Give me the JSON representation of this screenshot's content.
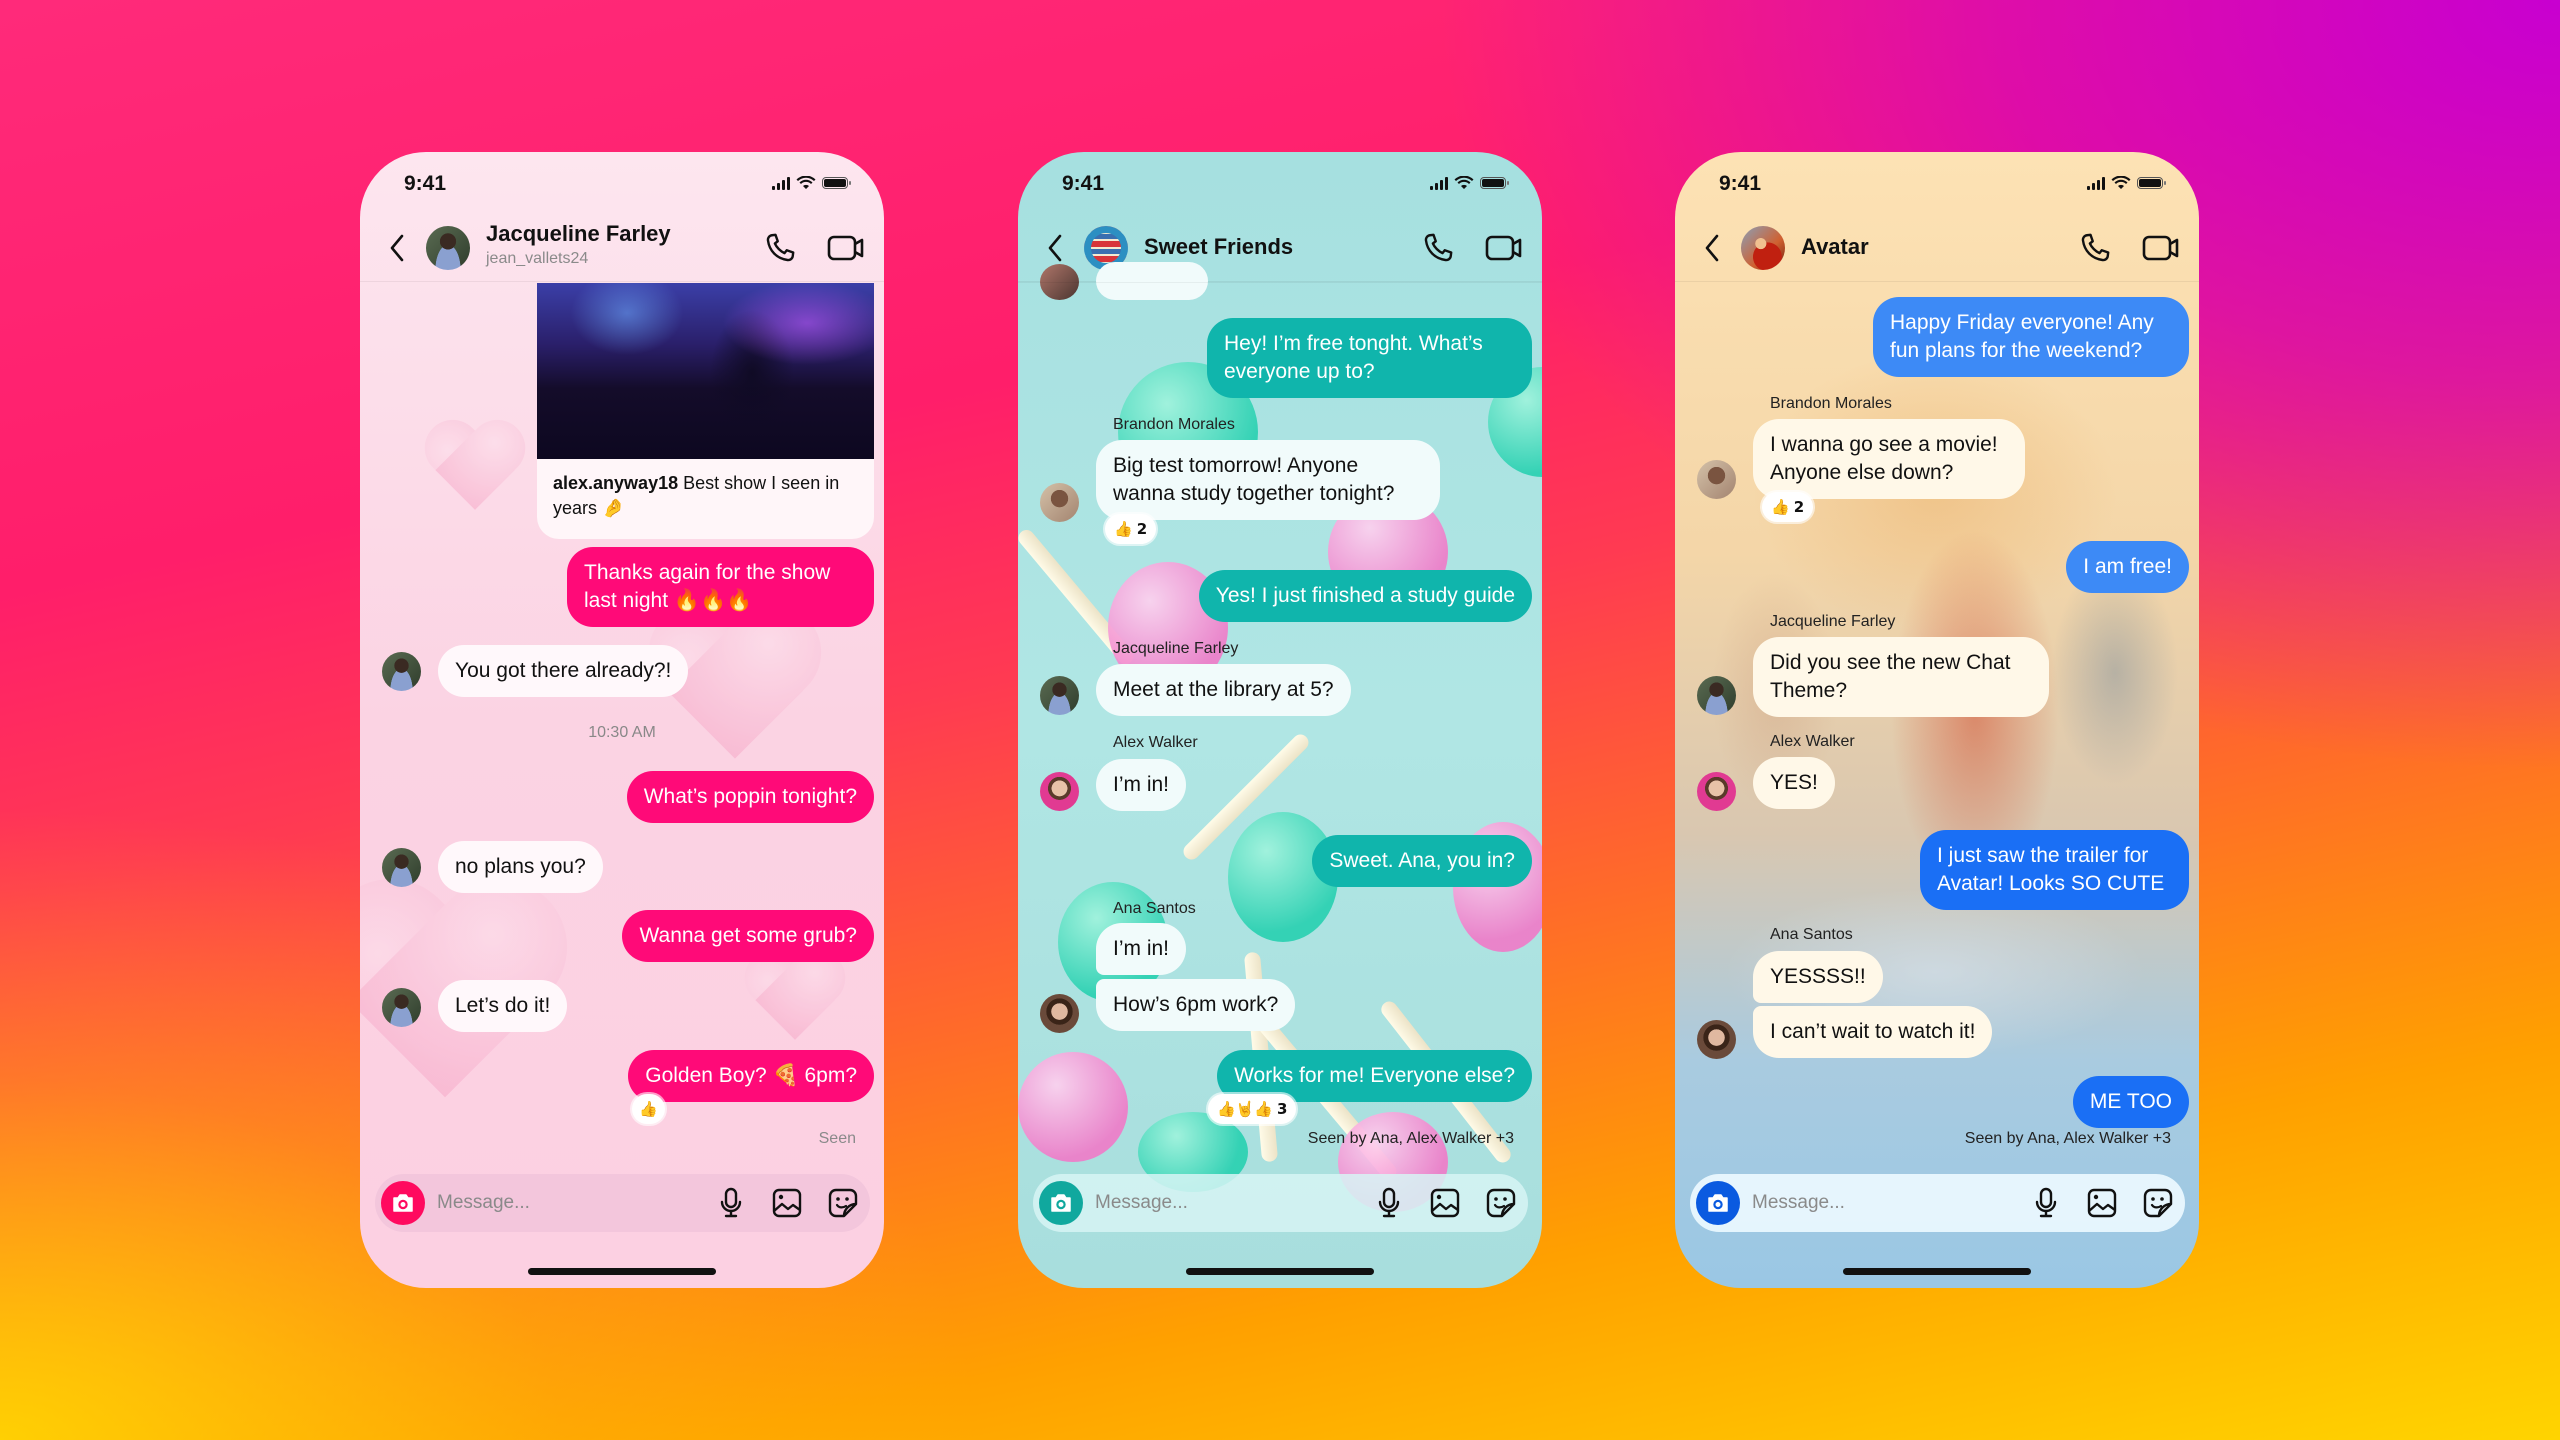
{
  "colors": {
    "pink_outgoing": "#ff0a78",
    "teal_outgoing": "#10b5ac",
    "blue_outgoing": "#1a6ff5"
  },
  "phones": [
    {
      "theme": "hearts",
      "status": {
        "time": "9:41"
      },
      "header": {
        "title": "Jacqueline Farley",
        "subtitle": "jean_vallets24",
        "avatar": "person-avatar"
      },
      "shared_post": {
        "username": "alex.anyway18",
        "caption": "Best show I seen in years 🤌",
        "image": "concert-crowd-photo"
      },
      "messages": [
        {
          "type": "outgoing",
          "text": "Thanks again for the show\nlast night 🔥🔥🔥"
        },
        {
          "type": "incoming",
          "text": "You got there already?!"
        },
        {
          "type": "timestamp",
          "text": "10:30 AM"
        },
        {
          "type": "outgoing",
          "text": "What’s poppin tonight?"
        },
        {
          "type": "incoming",
          "text": "no plans you?"
        },
        {
          "type": "outgoing",
          "text": "Wanna get some grub?"
        },
        {
          "type": "incoming",
          "text": "Let’s do it!"
        },
        {
          "type": "outgoing",
          "text": "Golden Boy? 🍕 6pm?",
          "reaction": "👍"
        }
      ],
      "seen": "Seen",
      "composer": {
        "placeholder": "Message..."
      }
    },
    {
      "theme": "lollipops",
      "status": {
        "time": "9:41"
      },
      "header": {
        "title": "Sweet Friends",
        "avatar": "books-group-avatar"
      },
      "messages": [
        {
          "type": "outgoing",
          "text": "Hey! I’m free tonght. What’s\neveryone up to?"
        },
        {
          "type": "incoming",
          "sender": "Brandon Morales",
          "text": "Big test tomorrow! Anyone\nwanna study together tonight?",
          "reaction": "👍",
          "reaction_count": "2"
        },
        {
          "type": "outgoing",
          "text": "Yes! I just finished a study guide"
        },
        {
          "type": "incoming",
          "sender": "Jacqueline Farley",
          "text": "Meet at the library at 5?"
        },
        {
          "type": "incoming",
          "sender": "Alex Walker",
          "text": "I’m in!"
        },
        {
          "type": "outgoing",
          "text": "Sweet. Ana, you in?"
        },
        {
          "type": "incoming",
          "sender": "Ana Santos",
          "text": "I’m in!"
        },
        {
          "type": "incoming",
          "text": "How’s 6pm work?"
        },
        {
          "type": "outgoing",
          "text": "Works for me! Everyone else?",
          "reaction": "👍🤘👍",
          "reaction_count": "3"
        }
      ],
      "seen": "Seen by Ana, Alex Walker +3",
      "composer": {
        "placeholder": "Message..."
      }
    },
    {
      "theme": "avatar-poster",
      "status": {
        "time": "9:41"
      },
      "header": {
        "title": "Avatar",
        "avatar": "avatar-show-avatar"
      },
      "messages": [
        {
          "type": "outgoing",
          "text": "Happy Friday everyone! Any\nfun plans for the weekend?"
        },
        {
          "type": "incoming",
          "sender": "Brandon Morales",
          "text": "I wanna go see a movie!\nAnyone else down?",
          "reaction": "👍",
          "reaction_count": "2"
        },
        {
          "type": "outgoing",
          "text": "I am free!"
        },
        {
          "type": "incoming",
          "sender": "Jacqueline Farley",
          "text": "Did you see the new Chat\nTheme?"
        },
        {
          "type": "incoming",
          "sender": "Alex Walker",
          "text": "YES!"
        },
        {
          "type": "outgoing",
          "text": "I just saw the trailer for\nAvatar! Looks SO CUTE"
        },
        {
          "type": "incoming",
          "sender": "Ana Santos",
          "text": "YESSSS!!"
        },
        {
          "type": "incoming",
          "text": "I can’t wait to watch it!"
        },
        {
          "type": "outgoing",
          "text": "ME TOO"
        }
      ],
      "seen": "Seen by Ana, Alex Walker +3",
      "composer": {
        "placeholder": "Message..."
      }
    }
  ]
}
